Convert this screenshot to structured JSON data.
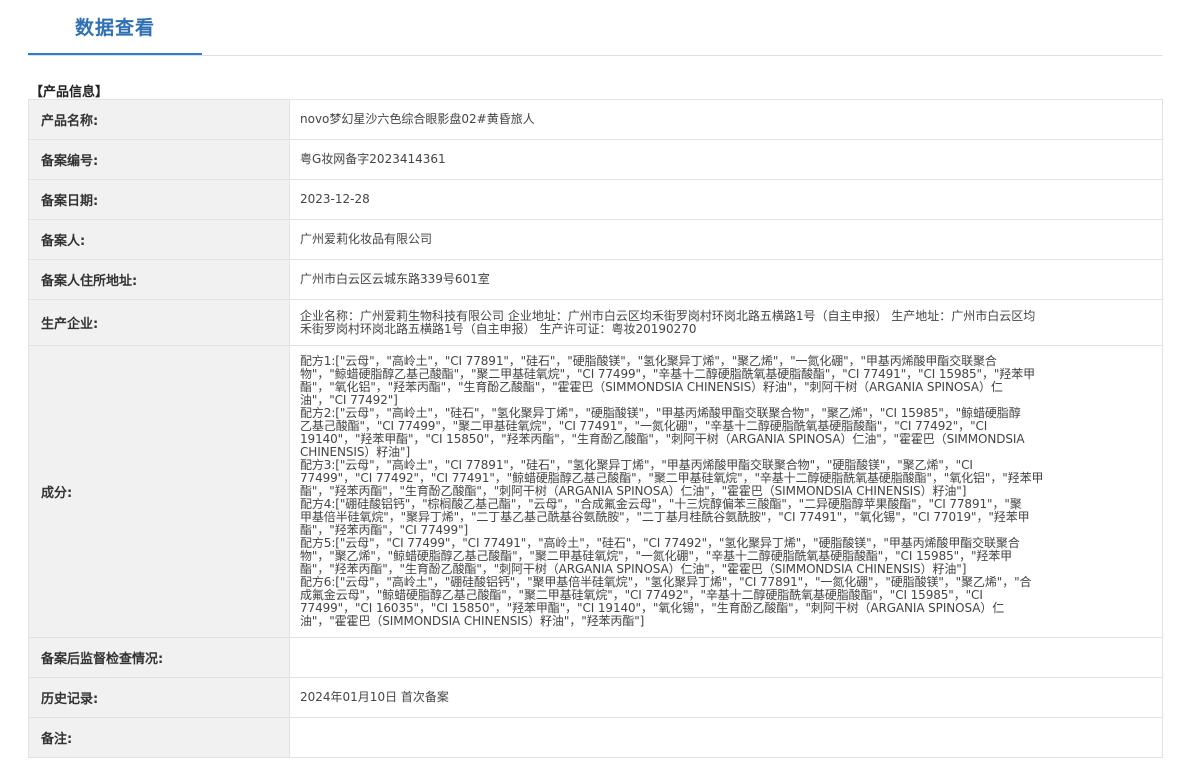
{
  "header": {
    "tab_title": "数据查看"
  },
  "section": {
    "title": "【产品信息】"
  },
  "rows": [
    {
      "label": "产品名称:",
      "value": "novo梦幻星沙六色综合眼影盘02#黄昏旅人"
    },
    {
      "label": "备案编号:",
      "value": "粤G妆网备字2023414361"
    },
    {
      "label": "备案日期:",
      "value": "2023-12-28"
    },
    {
      "label": "备案人:",
      "value": "广州爱莉化妆品有限公司"
    },
    {
      "label": "备案人住所地址:",
      "value": "广州市白云区云城东路339号601室"
    },
    {
      "label": "生产企业:",
      "value": "企业名称：广州爱莉生物科技有限公司 企业地址：广州市白云区均禾街罗岗村环岗北路五横路1号（自主申报） 生产地址：广州市白云区均\n禾街罗岗村环岗北路五横路1号（自主申报） 生产许可证：粤妆20190270"
    },
    {
      "label": "成分:",
      "value": "配方1:[\"云母\"，\"高岭土\"，\"CI 77891\"，\"硅石\"，\"硬脂酸镁\"，\"氢化聚异丁烯\"，\"聚乙烯\"，\"一氮化硼\"，\"甲基丙烯酸甲酯交联聚合\n物\"，\"鲸蜡硬脂醇乙基己酸酯\"，\"聚二甲基硅氧烷\"，\"CI 77499\"，\"辛基十二醇硬脂酰氧基硬脂酸酯\"，\"CI 77491\"，\"CI 15985\"，\"羟苯甲\n酯\"，\"氧化铝\"，\"羟苯丙酯\"，\"生育酚乙酸酯\"，\"霍霍巴（SIMMONDSIA CHINENSIS）籽油\"，\"刺阿干树（ARGANIA SPINOSA）仁\n油\"，\"CI 77492\"]\n配方2:[\"云母\"，\"高岭土\"，\"硅石\"，\"氢化聚异丁烯\"，\"硬脂酸镁\"，\"甲基丙烯酸甲酯交联聚合物\"，\"聚乙烯\"，\"CI 15985\"，\"鲸蜡硬脂醇\n乙基己酸酯\"，\"CI 77499\"，\"聚二甲基硅氧烷\"，\"CI 77491\"，\"一氮化硼\"，\"辛基十二醇硬脂酰氧基硬脂酸酯\"，\"CI 77492\"，\"CI\n19140\"，\"羟苯甲酯\"，\"CI 15850\"，\"羟苯丙酯\"，\"生育酚乙酸酯\"，\"刺阿干树（ARGANIA SPINOSA）仁油\"，\"霍霍巴（SIMMONDSIA\nCHINENSIS）籽油\"]\n配方3:[\"云母\"，\"高岭土\"，\"CI 77891\"，\"硅石\"，\"氢化聚异丁烯\"，\"甲基丙烯酸甲酯交联聚合物\"，\"硬脂酸镁\"，\"聚乙烯\"，\"CI\n77499\"，\"CI 77492\"，\"CI 77491\"，\"鲸蜡硬脂醇乙基己酸酯\"，\"聚二甲基硅氧烷\"，\"辛基十二醇硬脂酰氧基硬脂酸酯\"，\"氧化铝\"，\"羟苯甲\n酯\"，\"羟苯丙酯\"，\"生育酚乙酸酯\"，\"刺阿干树（ARGANIA SPINOSA）仁油\"，\"霍霍巴（SIMMONDSIA CHINENSIS）籽油\"]\n配方4:[\"硼硅酸铝钙\"，\"棕榈酸乙基己酯\"，\"云母\"，\"合成氟金云母\"，\"十三烷醇偏苯三酸酯\"，\"二异硬脂醇苹果酸酯\"，\"CI 77891\"，\"聚\n甲基倍半硅氧烷\"，\"聚异丁烯\"，\"二丁基乙基己酰基谷氨酰胺\"，\"二丁基月桂酰谷氨酰胺\"，\"CI 77491\"，\"氧化锡\"，\"CI 77019\"，\"羟苯甲\n酯\"，\"羟苯丙酯\"，\"CI 77499\"]\n配方5:[\"云母\"，\"CI 77499\"，\"CI 77491\"，\"高岭土\"，\"硅石\"，\"CI 77492\"，\"氢化聚异丁烯\"，\"硬脂酸镁\"，\"甲基丙烯酸甲酯交联聚合\n物\"，\"聚乙烯\"，\"鲸蜡硬脂醇乙基己酸酯\"，\"聚二甲基硅氧烷\"，\"一氮化硼\"，\"辛基十二醇硬脂酰氧基硬脂酸酯\"，\"CI 15985\"，\"羟苯甲\n酯\"，\"羟苯丙酯\"，\"生育酚乙酸酯\"，\"刺阿干树（ARGANIA SPINOSA）仁油\"，\"霍霍巴（SIMMONDSIA CHINENSIS）籽油\"]\n配方6:[\"云母\"，\"高岭土\"，\"硼硅酸铝钙\"，\"聚甲基倍半硅氧烷\"，\"氢化聚异丁烯\"，\"CI 77891\"，\"一氮化硼\"，\"硬脂酸镁\"，\"聚乙烯\"，\"合\n成氟金云母\"，\"鲸蜡硬脂醇乙基己酸酯\"，\"聚二甲基硅氧烷\"，\"CI 77492\"，\"辛基十二醇硬脂酰氧基硬脂酸酯\"，\"CI 15985\"，\"CI\n77499\"，\"CI 16035\"，\"CI 15850\"，\"羟苯甲酯\"，\"CI 19140\"，\"氧化锡\"，\"生育酚乙酸酯\"，\"刺阿干树（ARGANIA SPINOSA）仁\n油\"，\"霍霍巴（SIMMONDSIA CHINENSIS）籽油\"，\"羟苯丙酯\"]"
    },
    {
      "label": "备案后监督检查情况:",
      "value": ""
    },
    {
      "label": "历史记录:",
      "value": "2024年01月10日 首次备案"
    },
    {
      "label": "备注:",
      "value": ""
    }
  ]
}
